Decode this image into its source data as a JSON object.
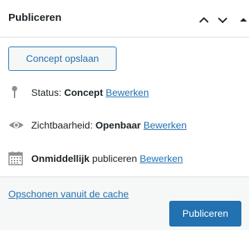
{
  "header": {
    "title": "Publiceren",
    "controls": [
      "chevron-up-icon",
      "chevron-down-icon",
      "caret-up-icon"
    ]
  },
  "actions": {
    "save_draft_label": "Concept opslaan"
  },
  "status": {
    "label": "Status:",
    "value": "Concept",
    "edit_label": "Bewerken",
    "icon": "pin-icon"
  },
  "visibility": {
    "label": "Zichtbaarheid:",
    "value": "Openbaar",
    "edit_label": "Bewerken",
    "icon": "eye-icon"
  },
  "schedule": {
    "value": "Onmiddellijk",
    "label": "publiceren",
    "edit_label": "Bewerken",
    "icon": "calendar-icon"
  },
  "footer": {
    "cache_link": "Opschonen vanuit de cache",
    "publish_label": "Publiceren"
  },
  "colors": {
    "accent": "#2271b1",
    "icon": "#8c8f94",
    "text": "#1d2327"
  }
}
